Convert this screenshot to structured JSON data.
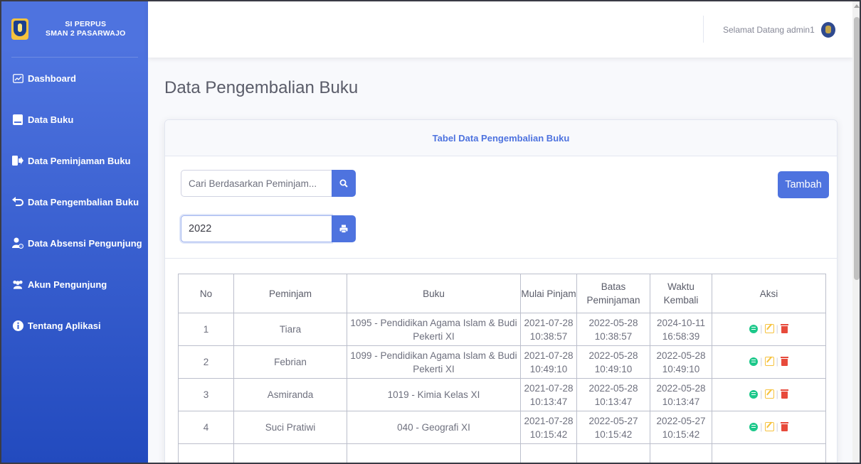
{
  "brand": {
    "line1": "SI PERPUS",
    "line2": "SMAN 2 PASARWAJO"
  },
  "sidebar": {
    "items": [
      {
        "label": "Dashboard",
        "icon": "chart-area-icon"
      },
      {
        "label": "Data Buku",
        "icon": "book-icon"
      },
      {
        "label": "Data Peminjaman Buku",
        "icon": "sign-out-icon"
      },
      {
        "label": "Data Pengembalian Buku",
        "icon": "undo-icon"
      },
      {
        "label": "Data Absensi Pengunjung",
        "icon": "user-clock-icon"
      },
      {
        "label": "Akun Pengunjung",
        "icon": "users-icon"
      },
      {
        "label": "Tentang Aplikasi",
        "icon": "info-circle-icon"
      }
    ]
  },
  "topbar": {
    "welcome": "Selamat Datang admin1"
  },
  "page": {
    "title": "Data Pengembalian Buku"
  },
  "card": {
    "header": "Tabel Data Pengembalian Buku",
    "search_placeholder": "Cari Berdasarkan Peminjam...",
    "year_value": "2022",
    "add_label": "Tambah"
  },
  "table": {
    "headers": [
      "No",
      "Peminjam",
      "Buku",
      "Mulai Pinjam",
      "Batas Peminjaman",
      "Waktu Kembali",
      "Aksi"
    ],
    "rows": [
      {
        "no": "1",
        "peminjam": "Tiara",
        "buku": "1095 - Pendidikan Agama Islam & Budi Pekerti XI",
        "mulai": "2021-07-28 10:38:57",
        "batas": "2022-05-28 10:38:57",
        "kembali": "2024-10-11 16:58:39"
      },
      {
        "no": "2",
        "peminjam": "Febrian",
        "buku": "1099 - Pendidikan Agama Islam & Budi Pekerti XI",
        "mulai": "2021-07-28 10:49:10",
        "batas": "2022-05-28 10:49:10",
        "kembali": "2022-05-28 10:49:10"
      },
      {
        "no": "3",
        "peminjam": "Asmiranda",
        "buku": "1019 - Kimia Kelas XI",
        "mulai": "2021-07-28 10:13:47",
        "batas": "2022-05-28 10:13:47",
        "kembali": "2022-05-28 10:13:47"
      },
      {
        "no": "4",
        "peminjam": "Suci Pratiwi",
        "buku": "040 - Geografi XI",
        "mulai": "2021-07-28 10:15:42",
        "batas": "2022-05-27 10:15:42",
        "kembali": "2022-05-27 10:15:42"
      }
    ]
  },
  "colors": {
    "primary": "#4e73df",
    "success": "#1cc88a",
    "warning": "#f6c23e",
    "danger": "#e74a3b"
  }
}
